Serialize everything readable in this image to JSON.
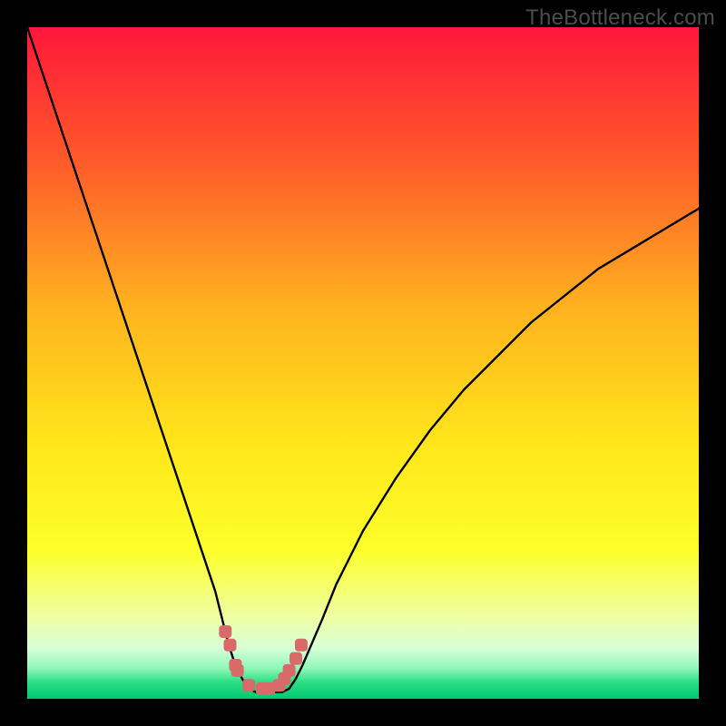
{
  "watermark": "TheBottleneck.com",
  "chart_data": {
    "type": "line",
    "title": "",
    "xlabel": "",
    "ylabel": "",
    "xlim": [
      0,
      100
    ],
    "ylim": [
      0,
      100
    ],
    "x": [
      0,
      2,
      4,
      6,
      8,
      10,
      12,
      14,
      16,
      18,
      20,
      22,
      24,
      26,
      28,
      30,
      31,
      32,
      33,
      34,
      35,
      36,
      37,
      38,
      39,
      40,
      41,
      44,
      46,
      48,
      50,
      55,
      60,
      65,
      70,
      75,
      80,
      85,
      90,
      95,
      100
    ],
    "y": [
      100,
      94,
      88,
      82,
      76,
      70,
      64,
      58,
      52,
      46,
      40,
      34,
      28,
      22,
      16,
      8,
      5,
      3,
      1.5,
      1,
      1,
      1,
      1,
      1,
      1.5,
      3,
      5,
      12,
      17,
      21,
      25,
      33,
      40,
      46,
      51,
      56,
      60,
      64,
      67,
      70,
      73
    ],
    "markers": {
      "x": [
        29.5,
        30.2,
        31,
        31.3,
        33,
        35,
        36,
        37.5,
        38.3,
        39,
        40,
        40.8
      ],
      "y": [
        10,
        8,
        5,
        4.2,
        2,
        1.5,
        1.5,
        2,
        3,
        4.2,
        6,
        8
      ]
    },
    "gradient_stops": [
      {
        "offset": 0.0,
        "color": "#ff173a"
      },
      {
        "offset": 0.2,
        "color": "#ff5a2a"
      },
      {
        "offset": 0.42,
        "color": "#ffb31f"
      },
      {
        "offset": 0.62,
        "color": "#ffe61a"
      },
      {
        "offset": 0.78,
        "color": "#fdff2a"
      },
      {
        "offset": 0.88,
        "color": "#efffa6"
      },
      {
        "offset": 0.925,
        "color": "#d7ffd7"
      },
      {
        "offset": 0.955,
        "color": "#8ef7b8"
      },
      {
        "offset": 0.975,
        "color": "#2bdf86"
      },
      {
        "offset": 1.0,
        "color": "#00c86f"
      }
    ],
    "marker_color": "#d86a6a",
    "curve_color": "#000000"
  }
}
